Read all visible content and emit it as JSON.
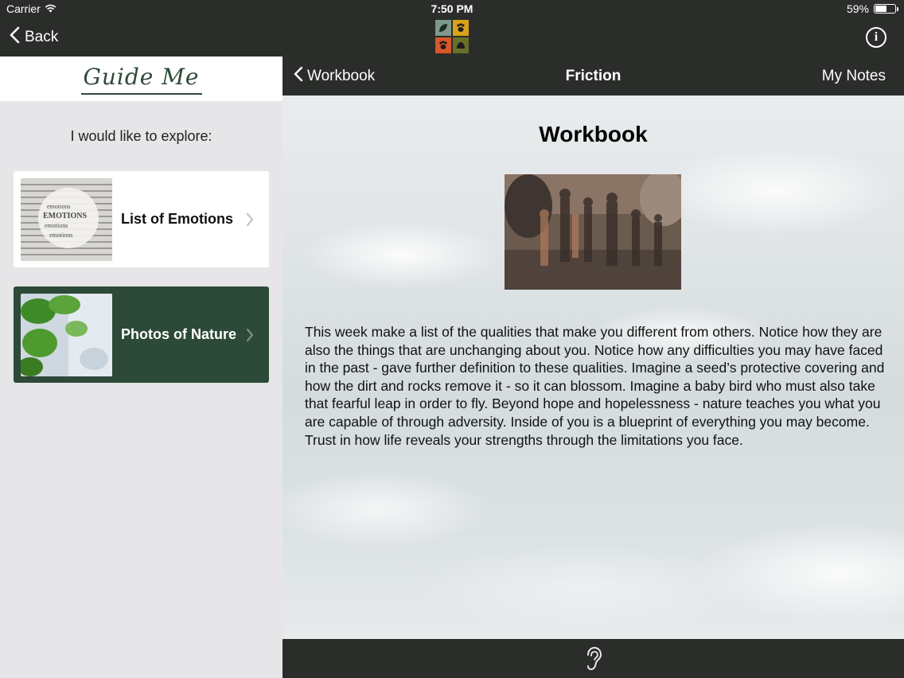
{
  "status_bar": {
    "carrier": "Carrier",
    "time": "7:50 PM",
    "battery": "59%",
    "battery_level": 0.59
  },
  "top_nav": {
    "back_label": "Back",
    "logo_tiles": [
      "leaf-icon",
      "paw-icon",
      "paw-icon",
      "shell-icon"
    ],
    "logo_colors": [
      "#7d9a8a",
      "#d9a21a",
      "#d9582a",
      "#6a6f2a"
    ],
    "info_label": "i"
  },
  "sidebar": {
    "title": "Guide Me",
    "prompt": "I would like to explore:",
    "items": [
      {
        "label": "List of Emotions",
        "style": "light"
      },
      {
        "label": "Photos of Nature",
        "style": "dark"
      }
    ]
  },
  "main_nav": {
    "back_label": "Workbook",
    "title": "Friction",
    "notes_label": "My Notes"
  },
  "content": {
    "title": "Workbook",
    "body": "This week make a list of the qualities that make you different from others. Notice how they are also the things that are unchanging about you. Notice how any difficulties you may have faced in the past - gave further definition to these qualities. Imagine a seed’s protective covering and how the dirt and rocks remove it - so it can blossom. Imagine a baby bird who must also take that fearful leap in order to fly. Beyond hope and hopelessness - nature teaches you what you are capable of through adversity. Inside of you is a blueprint of everything you may become. Trust in how life reveals your strengths through the limitations you face."
  },
  "bottom_bar": {
    "icon": "ear-icon"
  },
  "colors": {
    "bar_background": "#2b2d2b",
    "sidebar_background": "#e6e5e8",
    "accent_green": "#2d4a38"
  }
}
